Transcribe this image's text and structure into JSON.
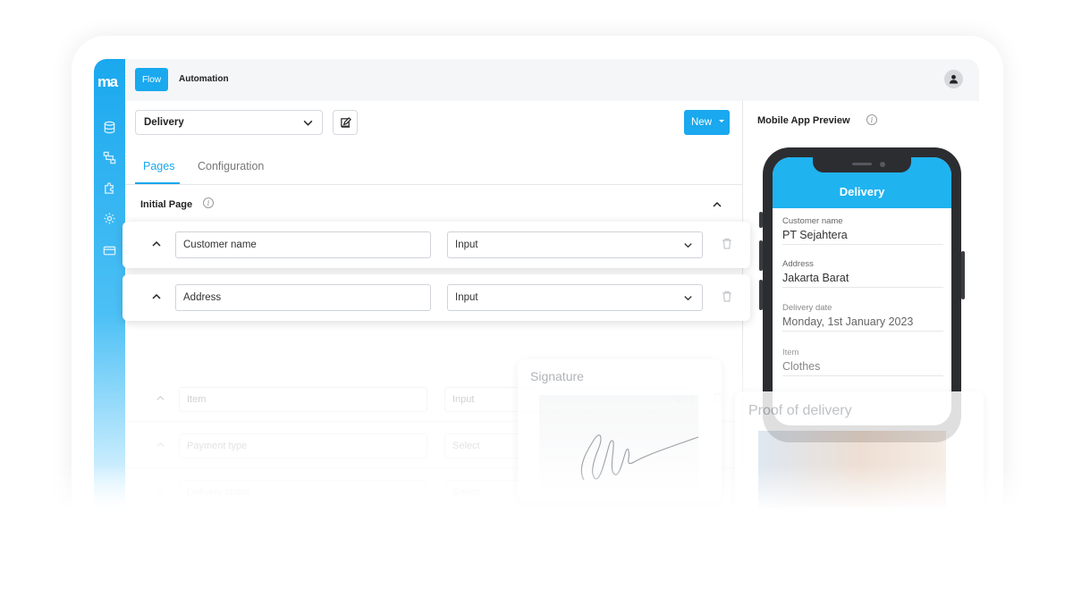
{
  "brand": {
    "logo_text": "ma",
    "accent": "#1aa8ee"
  },
  "topbar": {
    "tabs": [
      {
        "label": "Flow",
        "active": true
      },
      {
        "label": "Automation",
        "active": false
      }
    ],
    "avatar_icon": "user-icon"
  },
  "toolbar": {
    "flow_value": "Delivery",
    "new_label": "New"
  },
  "page_tabs": [
    {
      "label": "Pages",
      "active": true
    },
    {
      "label": "Configuration",
      "active": false
    }
  ],
  "section": {
    "title": "Initial Page"
  },
  "fields": [
    {
      "name": "Customer name",
      "type": "Input",
      "highlighted": true
    },
    {
      "name": "Address",
      "type": "Input",
      "highlighted": true
    },
    {
      "name": "Item",
      "type": "Input",
      "highlighted": false
    },
    {
      "name": "Payment type",
      "type": "Select",
      "highlighted": false
    },
    {
      "name": "Delivery status",
      "type": "Select",
      "highlighted": false
    }
  ],
  "preview": {
    "title": "Mobile App Preview",
    "app_title": "Delivery",
    "fields": [
      {
        "label": "Customer name",
        "value": "PT Sejahtera"
      },
      {
        "label": "Address",
        "value": "Jakarta Barat"
      },
      {
        "label": "Delivery date",
        "value": "Monday, 1st January 2023"
      },
      {
        "label": "Item",
        "value": "Clothes"
      }
    ]
  },
  "signature": {
    "title": "Signature"
  },
  "proof": {
    "title": "Proof of delivery"
  }
}
